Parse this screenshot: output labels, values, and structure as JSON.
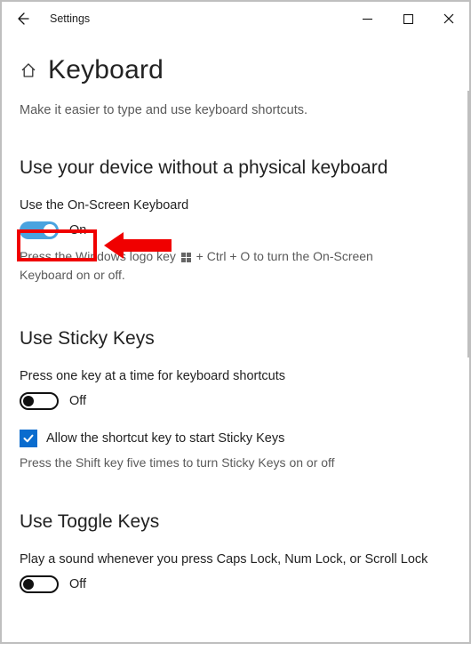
{
  "window": {
    "title": "Settings"
  },
  "page": {
    "title": "Keyboard",
    "subtitle": "Make it easier to type and use keyboard shortcuts."
  },
  "sections": {
    "physical": {
      "heading": "Use your device without a physical keyboard",
      "osk": {
        "label": "Use the On-Screen Keyboard",
        "state_label": "On",
        "on": true,
        "help_prefix": "Press the Windows logo key ",
        "help_suffix": " + Ctrl + O to turn the On-Screen Keyboard on or off."
      }
    },
    "sticky": {
      "heading": "Use Sticky Keys",
      "toggle": {
        "label": "Press one key at a time for keyboard shortcuts",
        "state_label": "Off",
        "on": false
      },
      "checkbox": {
        "label": "Allow the shortcut key to start Sticky Keys",
        "checked": true
      },
      "help": "Press the Shift key five times to turn Sticky Keys on or off"
    },
    "toggle_keys": {
      "heading": "Use Toggle Keys",
      "toggle": {
        "label": "Play a sound whenever you press Caps Lock, Num Lock, or Scroll Lock",
        "state_label": "Off",
        "on": false
      }
    }
  }
}
